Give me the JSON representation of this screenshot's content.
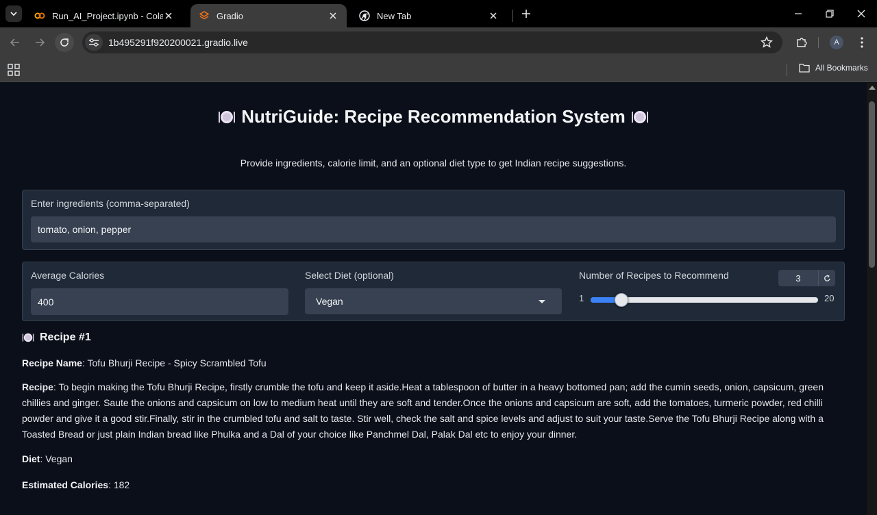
{
  "browser": {
    "tabs": [
      {
        "label": "Run_AI_Project.ipynb - Colab",
        "icon": "colab-icon",
        "active": false
      },
      {
        "label": "Gradio",
        "icon": "gradio-icon",
        "active": true
      },
      {
        "label": "New Tab",
        "icon": "chrome-icon",
        "active": false
      }
    ],
    "url": "1b495291f920200021.gradio.live",
    "profile_initial": "A",
    "bookmarks_label": "All Bookmarks"
  },
  "app": {
    "title": "NutriGuide: Recipe Recommendation System",
    "description": "Provide ingredients, calorie limit, and an optional diet type to get Indian recipe suggestions."
  },
  "inputs": {
    "ingredients": {
      "label": "Enter ingredients (comma-separated)",
      "value": "tomato, onion, pepper"
    },
    "calories": {
      "label": "Average Calories",
      "value": "400"
    },
    "diet": {
      "label": "Select Diet (optional)",
      "value": "Vegan"
    },
    "num_recipes": {
      "label": "Number of Recipes to Recommend",
      "value": 3,
      "min": 1,
      "max": 20,
      "min_label": "1",
      "max_label": "20",
      "value_label": "3"
    }
  },
  "output": {
    "recipe_heading": "Recipe #1",
    "name_label": "Recipe Name",
    "name_value": "Tofu Bhurji Recipe - Spicy Scrambled Tofu",
    "recipe_label": "Recipe",
    "recipe_value": "To begin making the Tofu Bhurji Recipe, firstly crumble the tofu and keep it aside.Heat a tablespoon of butter in a heavy bottomed pan; add the cumin seeds, onion, capsicum, green chillies and ginger. Saute the onions and capsicum on low to medium heat until they are soft and tender.Once the onions and capsicum are soft, add the tomatoes, turmeric powder, red chilli powder and give it a good stir.Finally, stir in the crumbled tofu and salt to taste. Stir well, check the salt and spice levels and adjust to suit your taste.Serve the Tofu Bhurji Recipe along with a Toasted Bread or just plain Indian bread like Phulka and a Dal of your choice like Panchmel Dal, Palak Dal etc to enjoy your dinner.",
    "diet_label": "Diet",
    "diet_value": "Vegan",
    "calories_label": "Estimated Calories",
    "calories_value": "182"
  },
  "colors": {
    "accent": "#3b82f6",
    "page_bg": "#0b0f19",
    "panel_bg": "#1f2937",
    "input_bg": "#374151"
  }
}
